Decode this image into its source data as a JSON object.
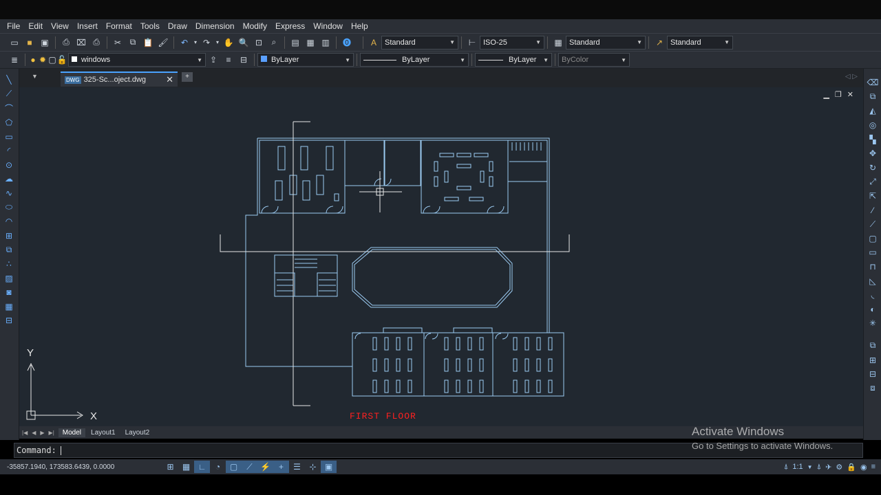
{
  "menu": [
    "File",
    "Edit",
    "View",
    "Insert",
    "Format",
    "Tools",
    "Draw",
    "Dimension",
    "Modify",
    "Express",
    "Window",
    "Help"
  ],
  "toolbar": {
    "text_style": "Standard",
    "dim_style": "ISO-25",
    "table_style": "Standard",
    "mleader_style": "Standard",
    "layer": "windows",
    "color": "ByLayer",
    "linetype": "ByLayer",
    "lineweight": "ByLayer",
    "plot_style": "ByColor"
  },
  "file_tab": {
    "name": "325-Sc...oject.dwg",
    "badge": "DWG"
  },
  "layout_tabs": [
    "Model",
    "Layout1",
    "Layout2"
  ],
  "drawing": {
    "label": "FIRST FLOOR",
    "label_color": "#ff2020",
    "line_color": "#9ccbf2",
    "ucs_x": "X",
    "ucs_y": "Y"
  },
  "command": {
    "prompt": "Command:"
  },
  "status": {
    "coords": "-35857.1940, 173583.6439, 0.0000",
    "scale": "1:1"
  },
  "watermark": {
    "title": "Activate Windows",
    "subtitle": "Go to Settings to activate Windows."
  }
}
